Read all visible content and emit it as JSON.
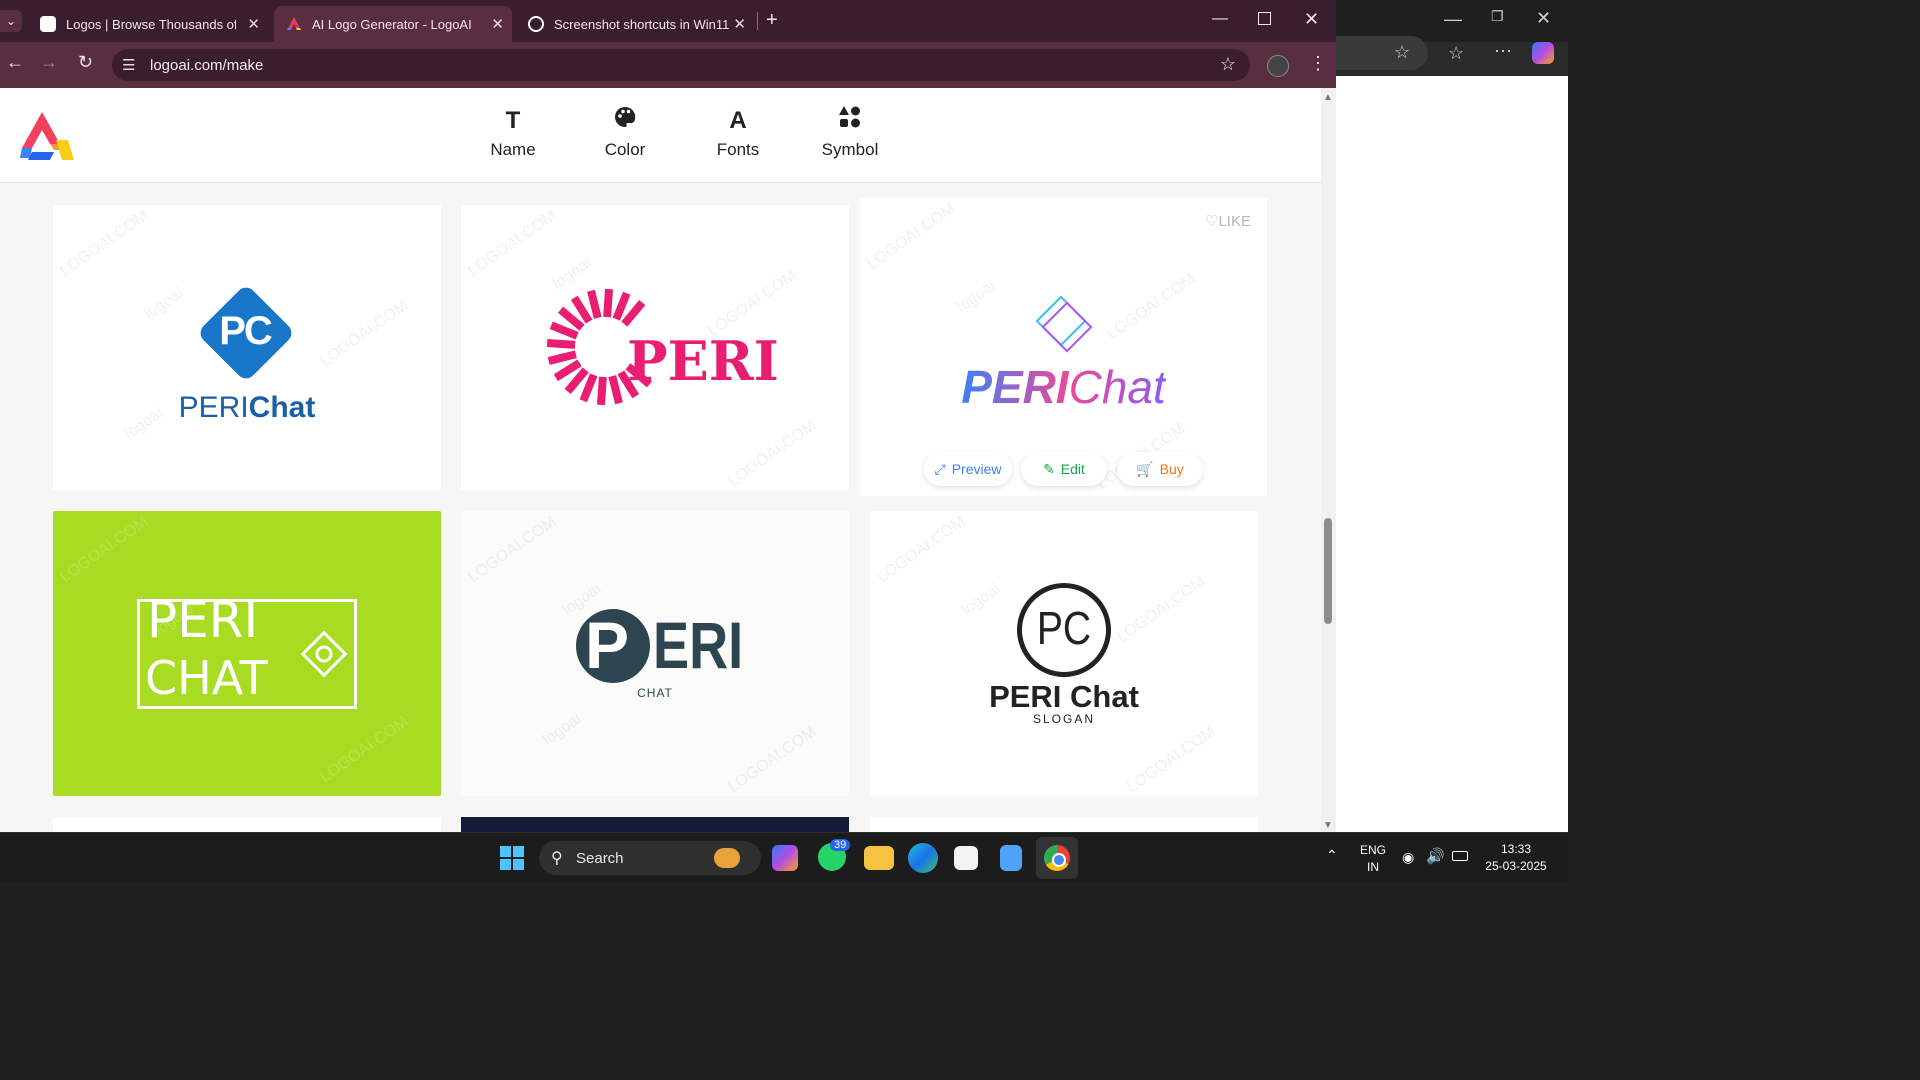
{
  "browser": {
    "tabs": [
      {
        "title": "Logos | Browse Thousands of Lo",
        "active": false
      },
      {
        "title": "AI Logo Generator - LogoAI",
        "active": true
      },
      {
        "title": "Screenshot shortcuts in Win11",
        "active": false
      }
    ],
    "new_tab": "+",
    "url": "logoai.com/make"
  },
  "toolbar": {
    "items": [
      {
        "label": "Name",
        "icon": "T"
      },
      {
        "label": "Color",
        "icon": "palette"
      },
      {
        "label": "Fonts",
        "icon": "A"
      },
      {
        "label": "Symbol",
        "icon": "shapes"
      }
    ]
  },
  "cards": [
    {
      "wordmark_a": "PERI",
      "wordmark_b": "Chat",
      "monogram": "PC"
    },
    {
      "wordmark": "PERI"
    },
    {
      "wordmark_a": "PERI",
      "wordmark_b": "Chat",
      "like": "LIKE",
      "actions": [
        "Preview",
        "Edit",
        "Buy"
      ]
    },
    {
      "line1": "PERI",
      "line2": "CHAT"
    },
    {
      "wordmark": "ERI",
      "initial": "P",
      "subtitle": "CHAT"
    },
    {
      "monogram": "PC",
      "wordmark": "PERI Chat",
      "slogan": "SLOGAN"
    }
  ],
  "watermark": {
    "site": "LOGOAI.COM",
    "brand": "logoai"
  },
  "taskbar": {
    "search_placeholder": "Search",
    "whatsapp_badge": "39",
    "lang": "ENG",
    "region": "IN",
    "time": "13:33",
    "date": "25-03-2025"
  },
  "colors": {
    "tabstrip": "#3b1e2d",
    "toolbar": "#5a2e41",
    "pc_blue": "#1877c9",
    "peri_pink": "#e91e73",
    "lime": "#a8dc22",
    "slate": "#2d4550"
  }
}
